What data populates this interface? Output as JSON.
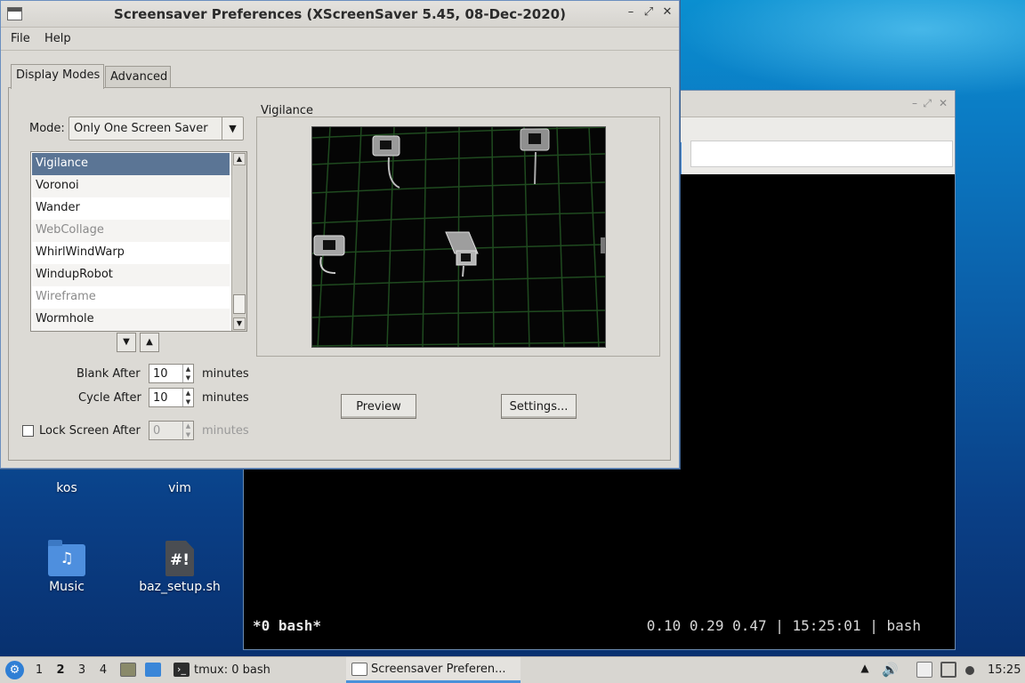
{
  "desktop": {
    "icons": [
      {
        "label": "kos",
        "icon": "folder-icon"
      },
      {
        "label": "vim",
        "icon": "folder-icon"
      },
      {
        "label": "Music",
        "icon": "music-folder-icon",
        "glyph": "♫"
      },
      {
        "label": "baz_setup.sh",
        "icon": "shell-script-icon",
        "glyph": "#!"
      }
    ]
  },
  "terminal": {
    "status_left": "*0 bash*",
    "status_right": "0.10 0.29 0.47 | 15:25:01 | bash"
  },
  "dialog": {
    "title": "Screensaver Preferences  (XScreenSaver 5.45, 08-Dec-2020)",
    "controls": {
      "minimize": "–",
      "maximize": "⤢",
      "close": "✕"
    },
    "menu": {
      "file": "File",
      "help": "Help"
    },
    "tabs": [
      {
        "label": "Display Modes",
        "active": true
      },
      {
        "label": "Advanced",
        "active": false
      }
    ],
    "mode_label": "Mode:",
    "mode_value": "Only One Screen Saver",
    "list": [
      {
        "label": "Vigilance",
        "state": "selected"
      },
      {
        "label": "Voronoi",
        "state": "normal"
      },
      {
        "label": "Wander",
        "state": "normal"
      },
      {
        "label": "WebCollage",
        "state": "disabled"
      },
      {
        "label": "WhirlWindWarp",
        "state": "normal"
      },
      {
        "label": "WindupRobot",
        "state": "normal"
      },
      {
        "label": "Wireframe",
        "state": "disabled"
      },
      {
        "label": "Wormhole",
        "state": "normal"
      }
    ],
    "list_nav": {
      "down": "▼",
      "up": "▲"
    },
    "blank_after": {
      "label": "Blank After",
      "value": "10",
      "unit": "minutes"
    },
    "cycle_after": {
      "label": "Cycle After",
      "value": "10",
      "unit": "minutes"
    },
    "lock_after": {
      "label": "Lock Screen After",
      "value": "0",
      "unit": "minutes",
      "checked": false,
      "enabled": false
    },
    "preview_title": "Vigilance",
    "preview_button": "Preview",
    "settings_button": "Settings..."
  },
  "taskbar": {
    "workspaces": [
      "1",
      "2",
      "3",
      "4"
    ],
    "current_workspace": "2",
    "tasks": [
      {
        "label": "tmux: 0 bash",
        "icon": "terminal-icon"
      },
      {
        "label": "Screensaver Preferen...",
        "icon": "window-icon",
        "active": true
      }
    ],
    "clock": "15:25"
  },
  "colors": {
    "selection": "#5b7595",
    "accent": "#4a90d9",
    "window_bg": "#dcdad5"
  }
}
